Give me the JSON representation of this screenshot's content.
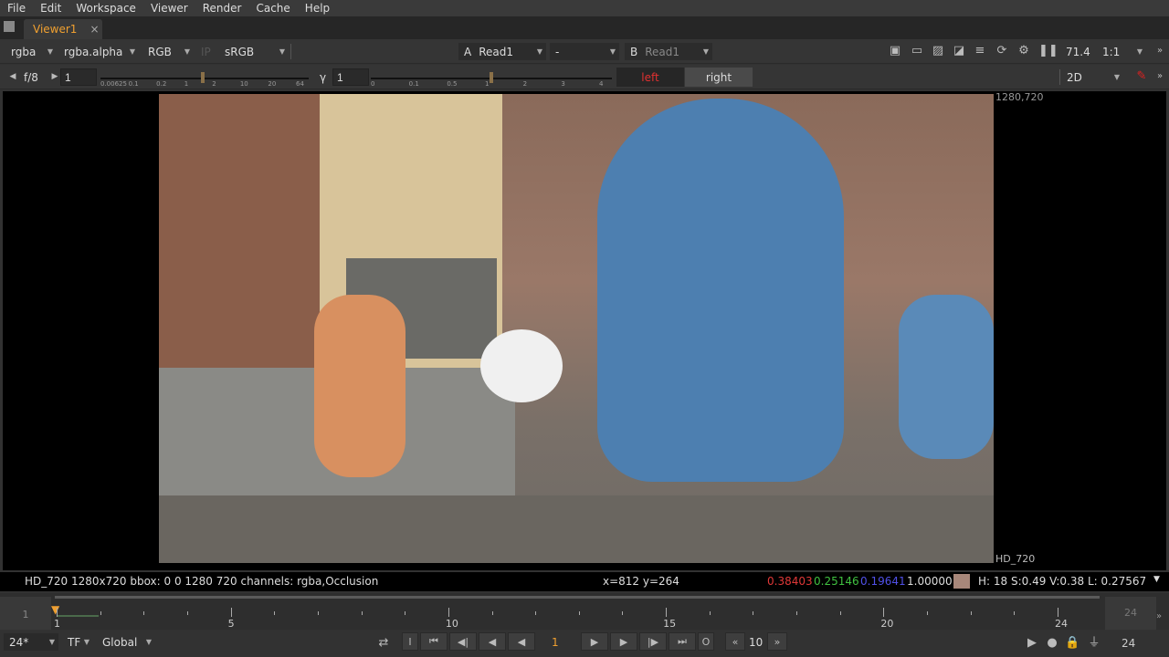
{
  "menu": [
    "File",
    "Edit",
    "Workspace",
    "Viewer",
    "Render",
    "Cache",
    "Help"
  ],
  "tab": {
    "label": "Viewer1",
    "close": "×"
  },
  "toolbar1": {
    "channels": "rgba",
    "alpha": "rgba.alpha",
    "display": "RGB",
    "ip": "IP",
    "lut": "sRGB",
    "a_label": "A",
    "a_input": "Read1",
    "op": "-",
    "b_label": "B",
    "b_input": "Read1",
    "zoom": "71.4",
    "ratio": "1:1"
  },
  "toolbar2": {
    "fstop": "f/8",
    "gain": "1",
    "gamma_label": "γ",
    "gamma": "1",
    "gain_ticks": [
      "0.00625",
      "0.1",
      "0.2",
      "1",
      "2",
      "10",
      "20",
      "64"
    ],
    "gamma_ticks": [
      "0",
      "0.1",
      "0.5",
      "1",
      "2",
      "3",
      "4"
    ],
    "left": "left",
    "right": "right",
    "mode": "2D"
  },
  "viewer": {
    "top_right": "1280,720",
    "bottom_right": "HD_720"
  },
  "info": {
    "format": "HD_720 1280x720  bbox: 0 0 1280 720 channels: rgba,Occlusion",
    "coords": "x=812 y=264",
    "r": "0.38403",
    "g": "0.25146",
    "b": "0.19641",
    "a": "1.00000",
    "swatch": "#a8877a",
    "hsvl": "H: 18 S:0.49 V:0.38  L: 0.27567"
  },
  "timeline": {
    "start": "1",
    "end": "24",
    "current": "1",
    "labels": [
      "1",
      "5",
      "10",
      "15",
      "20",
      "24"
    ]
  },
  "controls": {
    "fps": "24*",
    "tf": "TF",
    "global": "Global",
    "in": "I",
    "frame": "1",
    "out": "O",
    "step": "10",
    "end": "24"
  },
  "colors": {
    "accent": "#f0a030",
    "red": "#e03030",
    "green": "#40c040",
    "blue": "#4040e0"
  }
}
